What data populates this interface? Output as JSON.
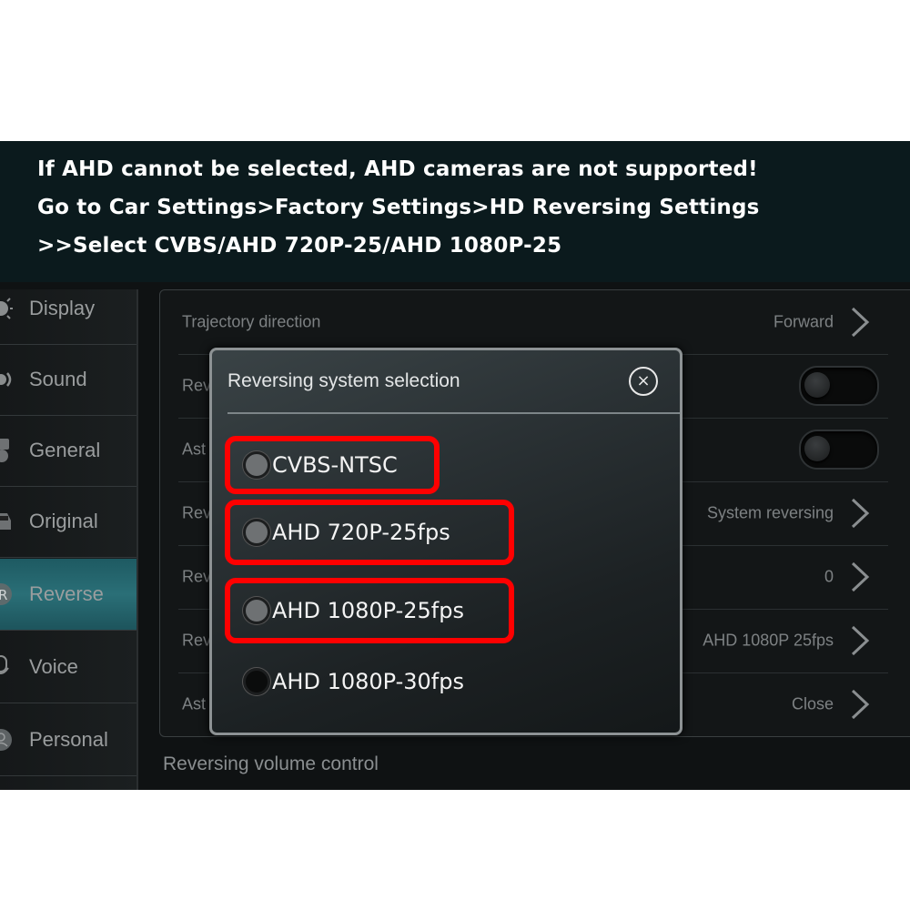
{
  "banner": {
    "lines": [
      "If AHD cannot be selected, AHD cameras are not supported!",
      "Go to Car Settings>Factory Settings>HD Reversing Settings",
      ">>Select CVBS/AHD 720P-25/AHD 1080P-25"
    ]
  },
  "sidebar": {
    "items": [
      {
        "label": "Display",
        "icon": "brightness-icon"
      },
      {
        "label": "Sound",
        "icon": "speaker-icon"
      },
      {
        "label": "General",
        "icon": "general-icon"
      },
      {
        "label": "Original",
        "icon": "car-icon"
      },
      {
        "label": "Reverse",
        "icon": "reverse-r-icon",
        "active": true
      },
      {
        "label": "Voice",
        "icon": "microphone-icon"
      },
      {
        "label": "Personal",
        "icon": "person-icon"
      }
    ]
  },
  "settings": {
    "rows": [
      {
        "label": "Trajectory direction",
        "value": "Forward",
        "control": "chevron"
      },
      {
        "label": "Rev",
        "value": "",
        "control": "toggle",
        "toggle_on": false
      },
      {
        "label": "Ast",
        "value": "",
        "control": "toggle",
        "toggle_on": false
      },
      {
        "label": "Rev",
        "value": "System reversing",
        "control": "chevron"
      },
      {
        "label": "Rev",
        "value": "0",
        "control": "chevron"
      },
      {
        "label": "Rev",
        "value": "AHD 1080P 25fps",
        "control": "chevron"
      },
      {
        "label": "Ast",
        "value": "Close",
        "control": "chevron"
      }
    ],
    "footer_label": "Reversing volume control"
  },
  "dialog": {
    "title": "Reversing system selection",
    "close_icon": "×",
    "options": [
      {
        "label": "CVBS-NTSC",
        "highlighted": true
      },
      {
        "label": "AHD 720P-25fps",
        "highlighted": true
      },
      {
        "label": "AHD 1080P-25fps",
        "highlighted": true
      },
      {
        "label": "AHD 1080P-30fps",
        "highlighted": false
      }
    ]
  },
  "colors": {
    "highlight": "#ff0000",
    "active_tab": "#2a6f77",
    "banner_bg": "#0b1a1d"
  }
}
